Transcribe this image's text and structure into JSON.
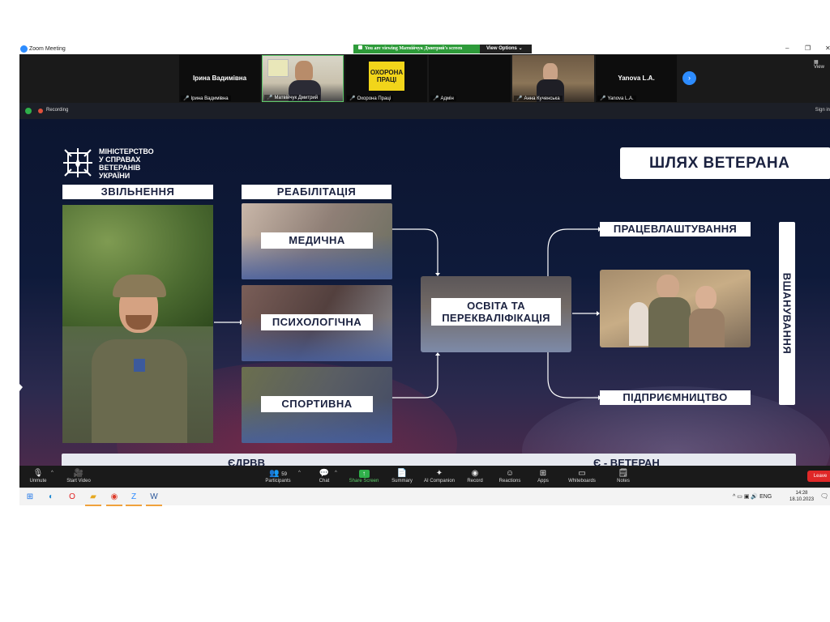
{
  "window": {
    "title": "Zoom Meeting",
    "viewing_banner": "You are viewing Матвійчук Дмитрий's screen",
    "view_options": "View Options",
    "controls": [
      "–",
      "❐",
      "✕"
    ]
  },
  "gallery": {
    "tiles": [
      {
        "name": "Ірина Вадимівна",
        "label": "Ірина Вадимівна",
        "muted": true
      },
      {
        "name": "",
        "label": "Матвійчук Дмитрий",
        "muted": true,
        "active": true
      },
      {
        "name": "",
        "label": "Охорона Праці",
        "muted": true,
        "logo_text": "ОХОРОНА ПРАЦІ"
      },
      {
        "name": "",
        "label": "Адмін",
        "muted": true
      },
      {
        "name": "",
        "label": "Анна Кученська",
        "muted": true
      },
      {
        "name": "Yanova L.A.",
        "label": "Yanova L.A.",
        "muted": true
      }
    ],
    "view_label": "View"
  },
  "status": {
    "recording": "Recording",
    "sign_in": "Sign in"
  },
  "slide": {
    "ministry": [
      "МІНІСТЕРСТВО",
      "У СПРАВАХ",
      "ВЕТЕРАНІВ",
      "УКРАЇНИ"
    ],
    "route_title": "ШЛЯХ ВЕТЕРАНА",
    "col_release": "ЗВІЛЬНЕННЯ",
    "col_rehab": "РЕАБІЛІТАЦІЯ",
    "rehab_items": [
      "МЕДИЧНА",
      "ПСИХОЛОГІЧНА",
      "СПОРТИВНА"
    ],
    "education": [
      "ОСВІТА ТА",
      "ПЕРЕКВАЛІФІКАЦІЯ"
    ],
    "employment": "ПРАЦЕВЛАШТУВАННЯ",
    "entrepreneurship": "ПІДПРИЄМНИЦТВО",
    "honoring": "ВШАНУВАННЯ",
    "bottom_left": "ЄДРВВ",
    "bottom_right": "Є - ВЕТЕРАН"
  },
  "toolbar": {
    "unmute": "Unmute",
    "start_video": "Start Video",
    "participants": "Participants",
    "participants_count": "59",
    "chat": "Chat",
    "share_screen": "Share Screen",
    "summary": "Summary",
    "ai_companion": "AI Companion",
    "record": "Record",
    "reactions": "Reactions",
    "apps": "Apps",
    "whiteboards": "Whiteboards",
    "notes": "Notes",
    "leave": "Leave"
  },
  "taskbar": {
    "lang": "ENG",
    "time": "14:28",
    "date": "18.10.2023"
  }
}
